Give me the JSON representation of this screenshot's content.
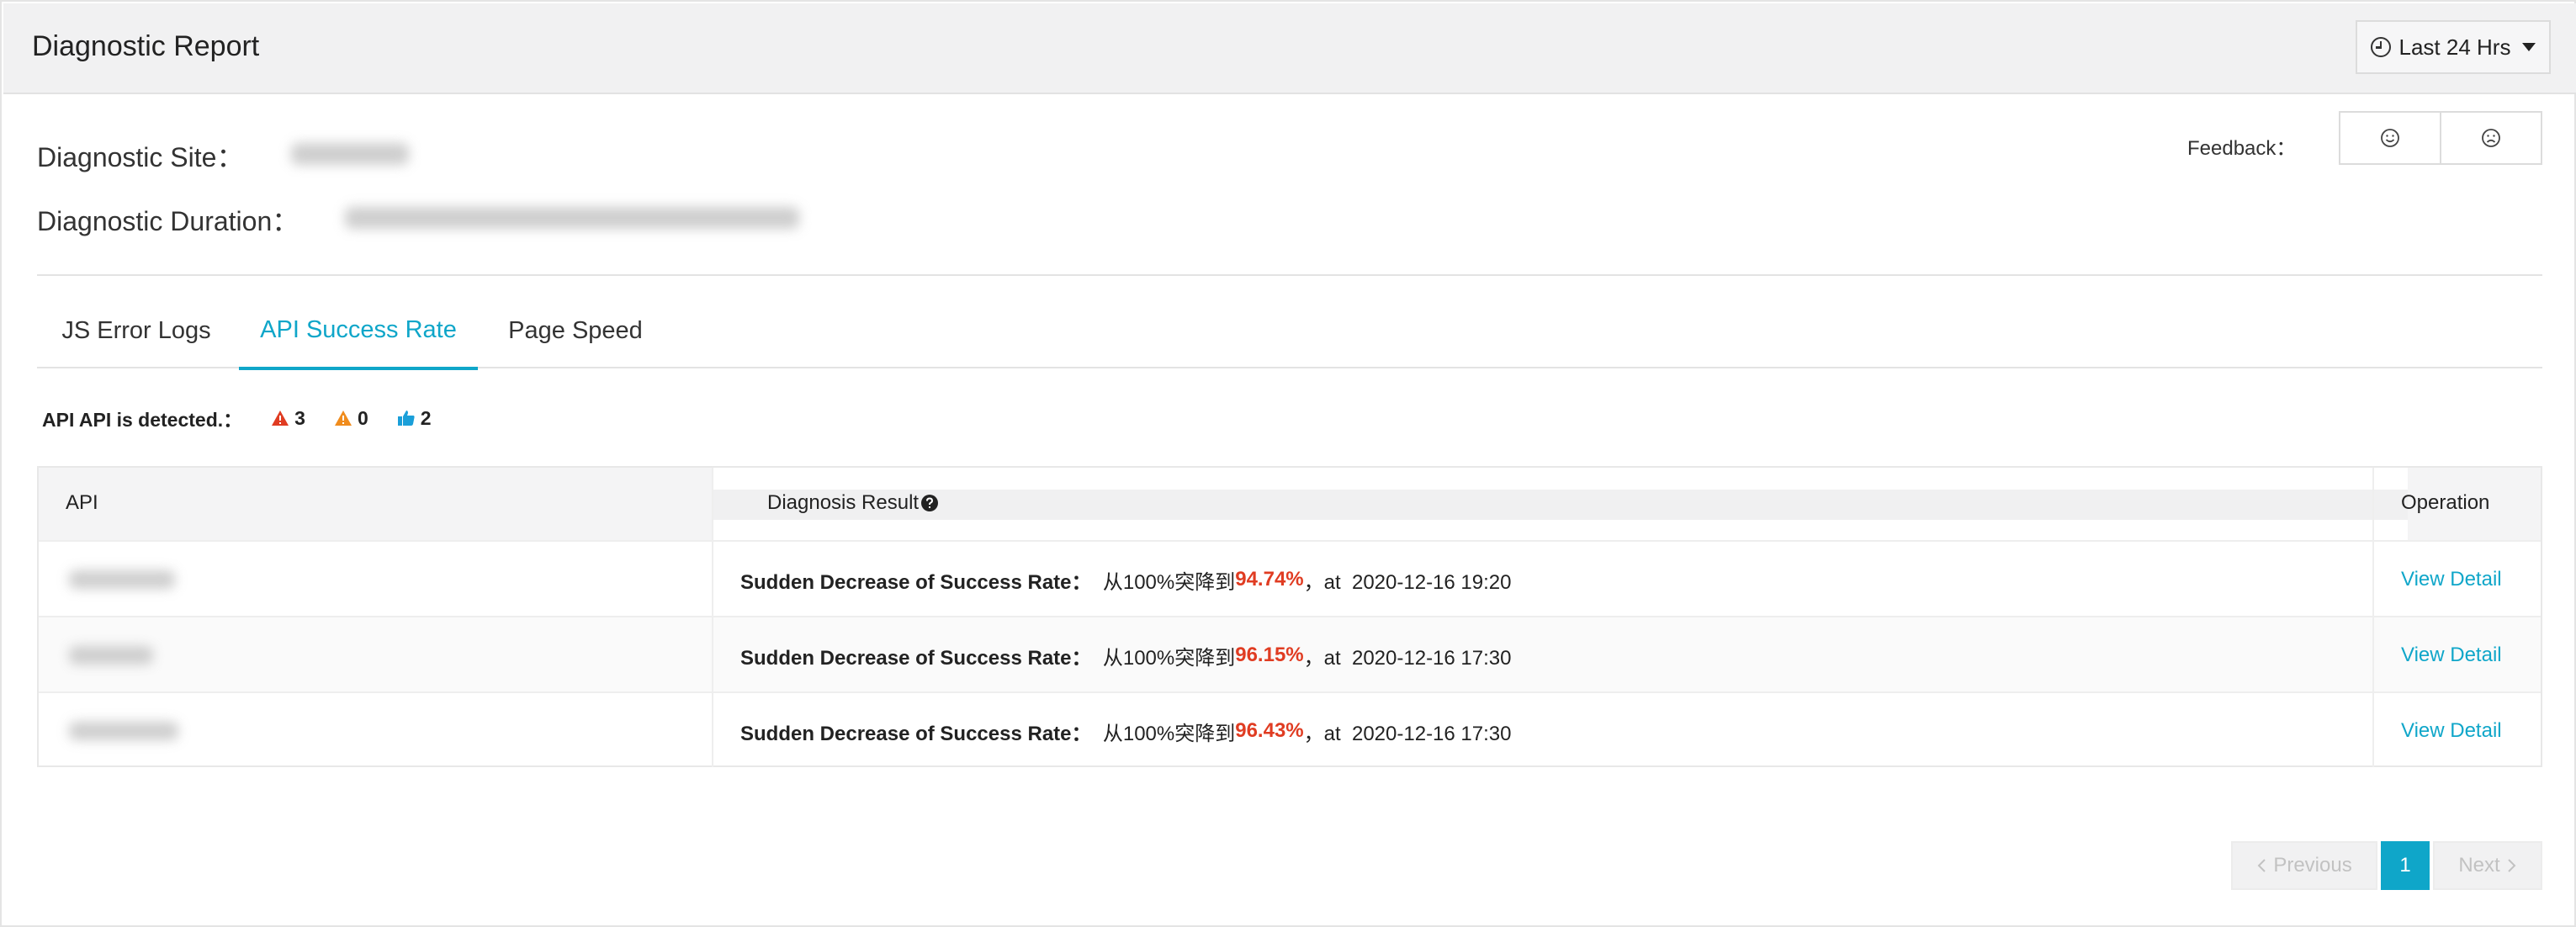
{
  "header": {
    "title": "Diagnostic Report",
    "time_range": "Last 24 Hrs"
  },
  "info": {
    "site_label": "Diagnostic Site：",
    "duration_label": "Diagnostic Duration："
  },
  "feedback": {
    "label": "Feedback："
  },
  "tabs": [
    {
      "label": "JS Error Logs"
    },
    {
      "label": "API Success Rate"
    },
    {
      "label": "Page Speed"
    }
  ],
  "summary": {
    "text": "API API is detected.：",
    "error_count": "3",
    "warning_count": "0",
    "good_count": "2"
  },
  "table": {
    "headers": {
      "api": "API",
      "result": "Diagnosis Result",
      "operation": "Operation"
    },
    "rows": [
      {
        "prefix": "Sudden Decrease of Success Rate：",
        "mid": "  从100%突降到",
        "rate": "94.74%",
        "suffix": "，at  2020-12-16 19:20",
        "action": "View Detail"
      },
      {
        "prefix": "Sudden Decrease of Success Rate：",
        "mid": "  从100%突降到",
        "rate": "96.15%",
        "suffix": "，at  2020-12-16 17:30",
        "action": "View Detail"
      },
      {
        "prefix": "Sudden Decrease of Success Rate：",
        "mid": "  从100%突降到",
        "rate": "96.43%",
        "suffix": "，at  2020-12-16 17:30",
        "action": "View Detail"
      }
    ]
  },
  "pagination": {
    "previous": "Previous",
    "current": "1",
    "next": "Next"
  },
  "colors": {
    "accent": "#0fa6c9",
    "error": "#e03c22",
    "warning": "#f08c1d"
  }
}
